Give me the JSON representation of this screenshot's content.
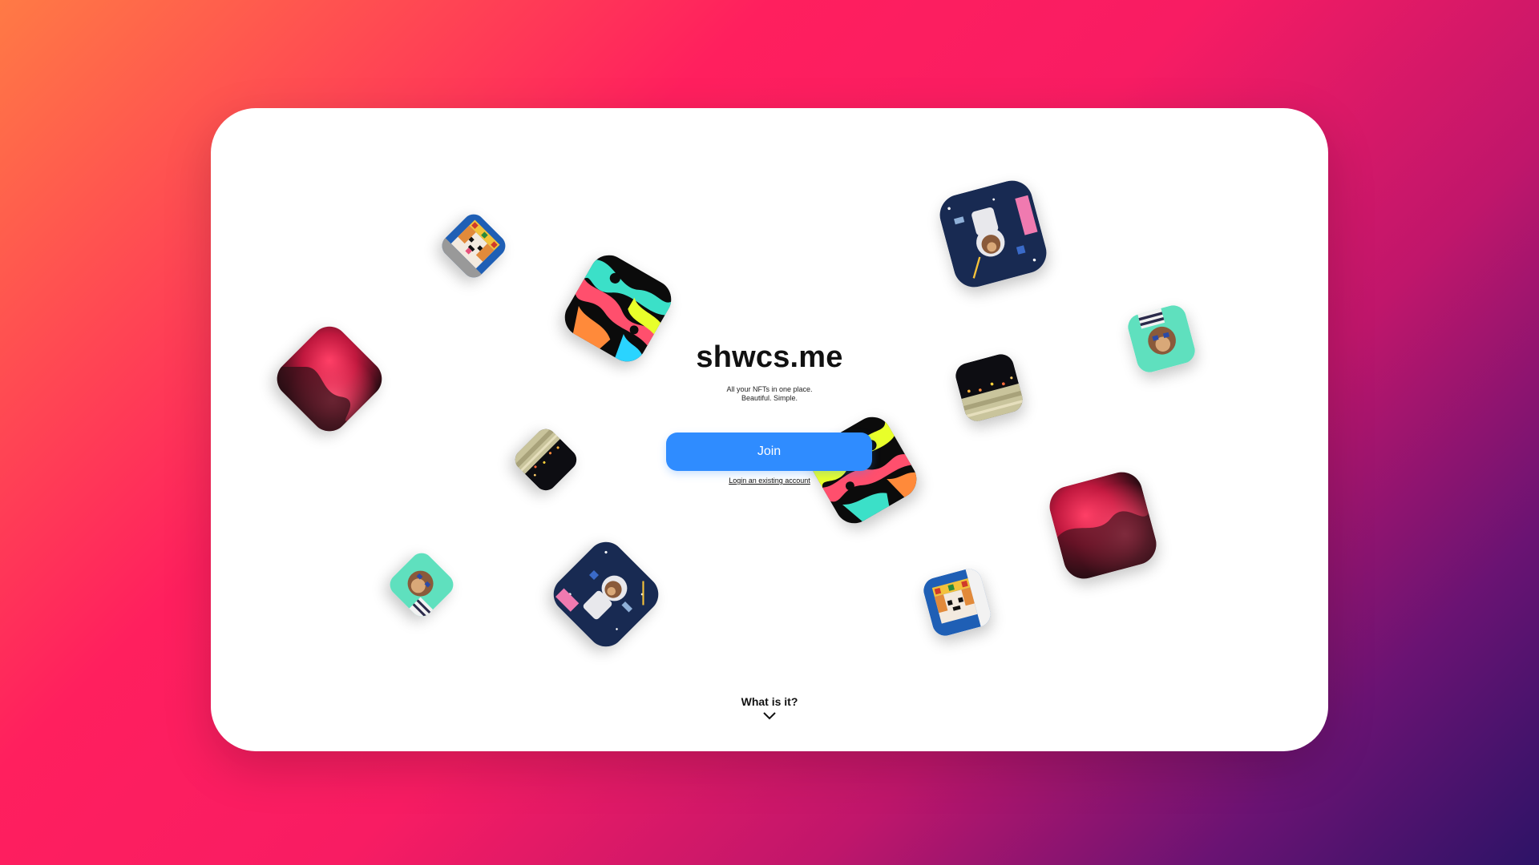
{
  "brand": {
    "title": "shwcs.me",
    "tagline_line1": "All your NFTs in one place.",
    "tagline_line2": "Beautiful. Simple."
  },
  "actions": {
    "join_label": "Join",
    "login_label": "Login an existing account"
  },
  "footer": {
    "what_is_it_label": "What is it?",
    "chevron_icon": "chevron-down-icon"
  },
  "colors": {
    "background_gradient": [
      "#ff7a45",
      "#ff1f5e",
      "#c0166b",
      "#2d1367"
    ],
    "card": "#ffffff",
    "join_button": "#2f8cff",
    "join_text": "#ffffff",
    "title_text": "#111111"
  },
  "decorations": {
    "nft_tiles": [
      {
        "kind": "shiba-crown"
      },
      {
        "kind": "neon-abstract"
      },
      {
        "kind": "red-abstract"
      },
      {
        "kind": "sand-strip"
      },
      {
        "kind": "ape-mint"
      },
      {
        "kind": "astronaut-monkey"
      },
      {
        "kind": "neon-abstract"
      },
      {
        "kind": "astronaut-monkey"
      },
      {
        "kind": "ape-mint"
      },
      {
        "kind": "sand-strip"
      },
      {
        "kind": "red-abstract"
      },
      {
        "kind": "shiba-crown"
      }
    ]
  }
}
